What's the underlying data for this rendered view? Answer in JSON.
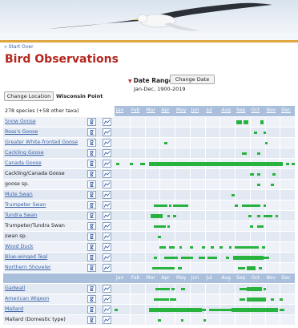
{
  "nav": {
    "start_over": "« Start Over"
  },
  "page": {
    "title": "Bird Observations"
  },
  "date": {
    "label": "Date Range:",
    "button": "Change Date",
    "value": "Jan-Dec, 1900-2019"
  },
  "location": {
    "button": "Change Location",
    "name": "Wisconsin Point"
  },
  "summary": {
    "species_count": "278 species (+58 other taxa)"
  },
  "months": [
    "Jan",
    "Feb",
    "Mar",
    "Apr",
    "May",
    "Jun",
    "Jul",
    "Aug",
    "Sep",
    "Oct",
    "Nov",
    "Dec"
  ],
  "colors": {
    "title": "#b5261e",
    "link": "#3b63a8",
    "bar": "#27b33e",
    "header": "#aabfdc",
    "banner_rule": "#e0a640"
  },
  "icons": {
    "photo": "photo-icon",
    "chart": "line-chart-icon"
  },
  "species": [
    {
      "name": "Snow Goose",
      "link": true,
      "bars": [
        [
          8.1,
          8.5,
          1
        ],
        [
          8.6,
          8.9,
          1
        ],
        [
          9.7,
          9.9,
          1
        ]
      ]
    },
    {
      "name": "Ross's Goose",
      "link": true,
      "bars": [
        [
          9.3,
          9.5,
          0
        ],
        [
          9.9,
          10.1,
          0
        ]
      ]
    },
    {
      "name": "Greater White-fronted Goose",
      "link": true,
      "bars": [
        [
          3.3,
          3.5,
          0
        ],
        [
          10.0,
          10.2,
          0
        ]
      ]
    },
    {
      "name": "Cackling Goose",
      "link": true,
      "bars": [
        [
          8.5,
          8.8,
          0
        ],
        [
          9.5,
          9.7,
          0
        ]
      ]
    },
    {
      "name": "Canada Goose",
      "link": true,
      "bars": [
        [
          0.1,
          0.3,
          0
        ],
        [
          1.0,
          1.2,
          0
        ],
        [
          1.7,
          2.0,
          0
        ],
        [
          2.3,
          4.5,
          1
        ],
        [
          4.5,
          5.0,
          1
        ],
        [
          5.0,
          7.8,
          1
        ],
        [
          7.8,
          10.0,
          1
        ],
        [
          10.0,
          11.2,
          1
        ],
        [
          11.4,
          11.6,
          0
        ],
        [
          11.8,
          12.0,
          0
        ]
      ]
    },
    {
      "name": "Cackling/Canada Goose",
      "link": false,
      "bars": [
        [
          9.0,
          9.3,
          0
        ],
        [
          9.5,
          9.7,
          0
        ],
        [
          10.5,
          10.7,
          0
        ]
      ]
    },
    {
      "name": "goose sp.",
      "link": false,
      "bars": [
        [
          9.5,
          9.7,
          0
        ],
        [
          10.4,
          10.6,
          0
        ]
      ]
    },
    {
      "name": "Mute Swan",
      "link": true,
      "bars": [
        [
          7.8,
          8.0,
          0
        ]
      ]
    },
    {
      "name": "Trumpeter Swan",
      "link": true,
      "bars": [
        [
          2.6,
          3.5,
          0
        ],
        [
          3.6,
          3.8,
          0
        ],
        [
          3.9,
          4.9,
          0
        ],
        [
          8.0,
          8.2,
          0
        ],
        [
          8.5,
          9.7,
          0
        ],
        [
          9.9,
          10.1,
          0
        ]
      ]
    },
    {
      "name": "Tundra Swan",
      "link": true,
      "bars": [
        [
          2.4,
          3.2,
          1
        ],
        [
          3.5,
          3.7,
          0
        ],
        [
          3.9,
          4.1,
          0
        ],
        [
          8.9,
          9.1,
          0
        ],
        [
          9.5,
          9.7,
          0
        ],
        [
          9.9,
          10.5,
          0
        ],
        [
          10.7,
          10.9,
          0
        ]
      ]
    },
    {
      "name": "Trumpeter/Tundra Swan",
      "link": false,
      "bars": [
        [
          2.6,
          3.4,
          0
        ],
        [
          3.5,
          3.7,
          0
        ],
        [
          9.0,
          9.2,
          0
        ],
        [
          9.5,
          9.9,
          0
        ]
      ]
    },
    {
      "name": "swan sp.",
      "link": false,
      "bars": [
        [
          2.9,
          3.1,
          0
        ]
      ]
    },
    {
      "name": "Wood Duck",
      "link": true,
      "bars": [
        [
          3.0,
          3.4,
          0
        ],
        [
          3.6,
          4.0,
          0
        ],
        [
          4.3,
          4.5,
          0
        ],
        [
          5.0,
          5.2,
          0
        ],
        [
          5.8,
          6.0,
          0
        ],
        [
          6.4,
          6.6,
          0
        ],
        [
          7.0,
          7.2,
          0
        ],
        [
          7.6,
          7.8,
          0
        ],
        [
          8.0,
          9.6,
          0
        ],
        [
          9.8,
          10.0,
          0
        ]
      ]
    },
    {
      "name": "Blue-winged Teal",
      "link": true,
      "bars": [
        [
          2.6,
          2.8,
          0
        ],
        [
          3.3,
          4.2,
          0
        ],
        [
          4.4,
          5.2,
          0
        ],
        [
          5.6,
          6.0,
          0
        ],
        [
          6.2,
          6.8,
          0
        ],
        [
          7.4,
          7.6,
          0
        ],
        [
          7.9,
          9.9,
          1
        ],
        [
          9.9,
          10.3,
          0
        ]
      ]
    },
    {
      "name": "Northern Shoveler",
      "link": true,
      "bars": [
        [
          2.5,
          4.0,
          0
        ],
        [
          4.2,
          4.5,
          0
        ],
        [
          8.2,
          8.7,
          0
        ],
        [
          8.8,
          9.4,
          1
        ],
        [
          9.6,
          9.8,
          0
        ]
      ]
    },
    {
      "name": "Gadwall",
      "link": true,
      "bars": [
        [
          2.7,
          3.7,
          0
        ],
        [
          3.8,
          4.0,
          0
        ],
        [
          4.4,
          4.7,
          0
        ],
        [
          8.3,
          8.8,
          0
        ],
        [
          8.8,
          9.8,
          1
        ],
        [
          9.9,
          10.1,
          0
        ]
      ]
    },
    {
      "name": "American Wigeon",
      "link": true,
      "bars": [
        [
          2.6,
          3.6,
          0
        ],
        [
          3.7,
          4.1,
          0
        ],
        [
          8.3,
          8.7,
          0
        ],
        [
          8.8,
          10.1,
          1
        ],
        [
          10.4,
          10.6,
          0
        ],
        [
          11.0,
          11.2,
          0
        ]
      ]
    },
    {
      "name": "Mallard",
      "link": true,
      "bars": [
        [
          0.0,
          0.2,
          0
        ],
        [
          2.3,
          4.0,
          1
        ],
        [
          4.0,
          5.8,
          1
        ],
        [
          5.8,
          6.1,
          0
        ],
        [
          6.3,
          7.8,
          0
        ],
        [
          7.8,
          10.9,
          1
        ],
        [
          11.0,
          11.3,
          0
        ]
      ]
    },
    {
      "name": "Mallard (Domestic type)",
      "link": false,
      "bars": [
        [
          2.9,
          3.1,
          0
        ],
        [
          4.4,
          4.6,
          0
        ],
        [
          5.9,
          6.1,
          0
        ]
      ]
    }
  ]
}
